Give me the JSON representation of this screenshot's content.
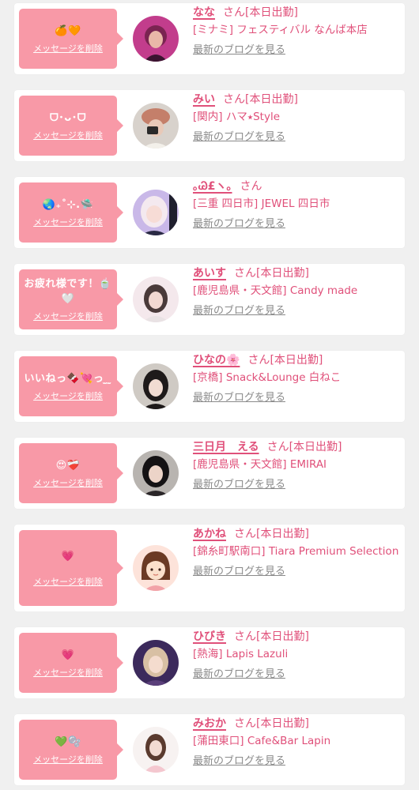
{
  "colors": {
    "bubble": "#f899a7",
    "accent": "#e0507a",
    "muted": "#8a8a8a",
    "card": "#ffffff",
    "background": "#f0f0f0"
  },
  "delete_label": "メッセージを削除",
  "blog_label": "最新のブログを見る",
  "san_label": "さん",
  "entries": [
    {
      "message": "🍊🧡",
      "name": "なな",
      "status": "[本日出勤]",
      "shop": "[ミナミ] フェスティバル なんば本店",
      "avatar_icon": "avatar-photo-icon"
    },
    {
      "message": "ᗜ･ᴗ･ᗜ",
      "name": "みい",
      "status": "[本日出勤]",
      "shop": "[関内] ハマ⭑Style",
      "avatar_icon": "avatar-photo-icon"
    },
    {
      "message": "🌏₊˚⊹.🛸",
      "name": "｡Ꮚ£ヽ｡",
      "status": "",
      "shop": "[三重 四日市] JEWEL 四日市",
      "avatar_icon": "avatar-photo-icon"
    },
    {
      "message": "お疲れ様です！🍵🤍",
      "name": "あいす",
      "status": "[本日出勤]",
      "shop": "[鹿児島県・天文館] Candy made",
      "avatar_icon": "avatar-photo-icon"
    },
    {
      "message": "いいねっ🍫💘っ ̫ ̫",
      "name": "ひなの🌸",
      "status": "[本日出勤]",
      "shop": "[京橋] Snack&Lounge 白ねこ",
      "avatar_icon": "avatar-photo-icon"
    },
    {
      "message": "😍❤️‍🩹",
      "name": "三日月　える",
      "status": "[本日出勤]",
      "shop": "[鹿児島県・天文館] EMIRAI",
      "avatar_icon": "avatar-photo-icon"
    },
    {
      "message": "💗",
      "name": "あかね",
      "status": "[本日出勤]",
      "shop": "[錦糸町駅南口] Tiara Premium Selection",
      "avatar_icon": "avatar-illustration-icon"
    },
    {
      "message": "💗",
      "name": "ひびき",
      "status": "[本日出勤]",
      "shop": "[熱海] Lapis Lazuli",
      "avatar_icon": "avatar-photo-icon"
    },
    {
      "message": "💚🫧",
      "name": "みおか",
      "status": "[本日出勤]",
      "shop": "[蒲田東口] Cafe&Bar Lapin",
      "avatar_icon": "avatar-photo-icon"
    }
  ]
}
